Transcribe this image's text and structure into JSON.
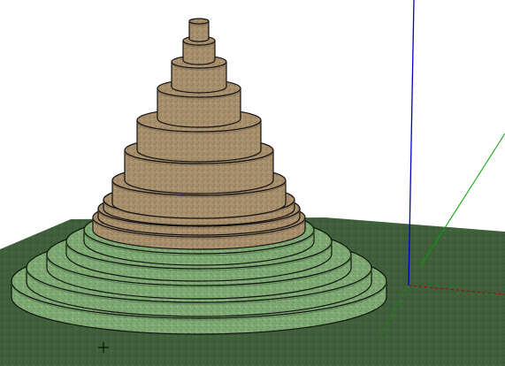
{
  "scene": {
    "background_color": "#ffffff",
    "ground_color": "#3f5f3a",
    "ground_texture_dark": "#2f4a2c",
    "stone_color": "#a88f6b",
    "stone_dark": "#6b5a45",
    "moss_color": "#7ea871",
    "moss_dark": "#3f6a3a",
    "tier_counts": {
      "stone_tiers": 11,
      "green_tiers": 5
    },
    "axes": {
      "x_color": "#c00000",
      "y_color": "#00a000",
      "z_color": "#0000c0"
    },
    "cursor_icon": "crosshair-cursor-icon"
  }
}
